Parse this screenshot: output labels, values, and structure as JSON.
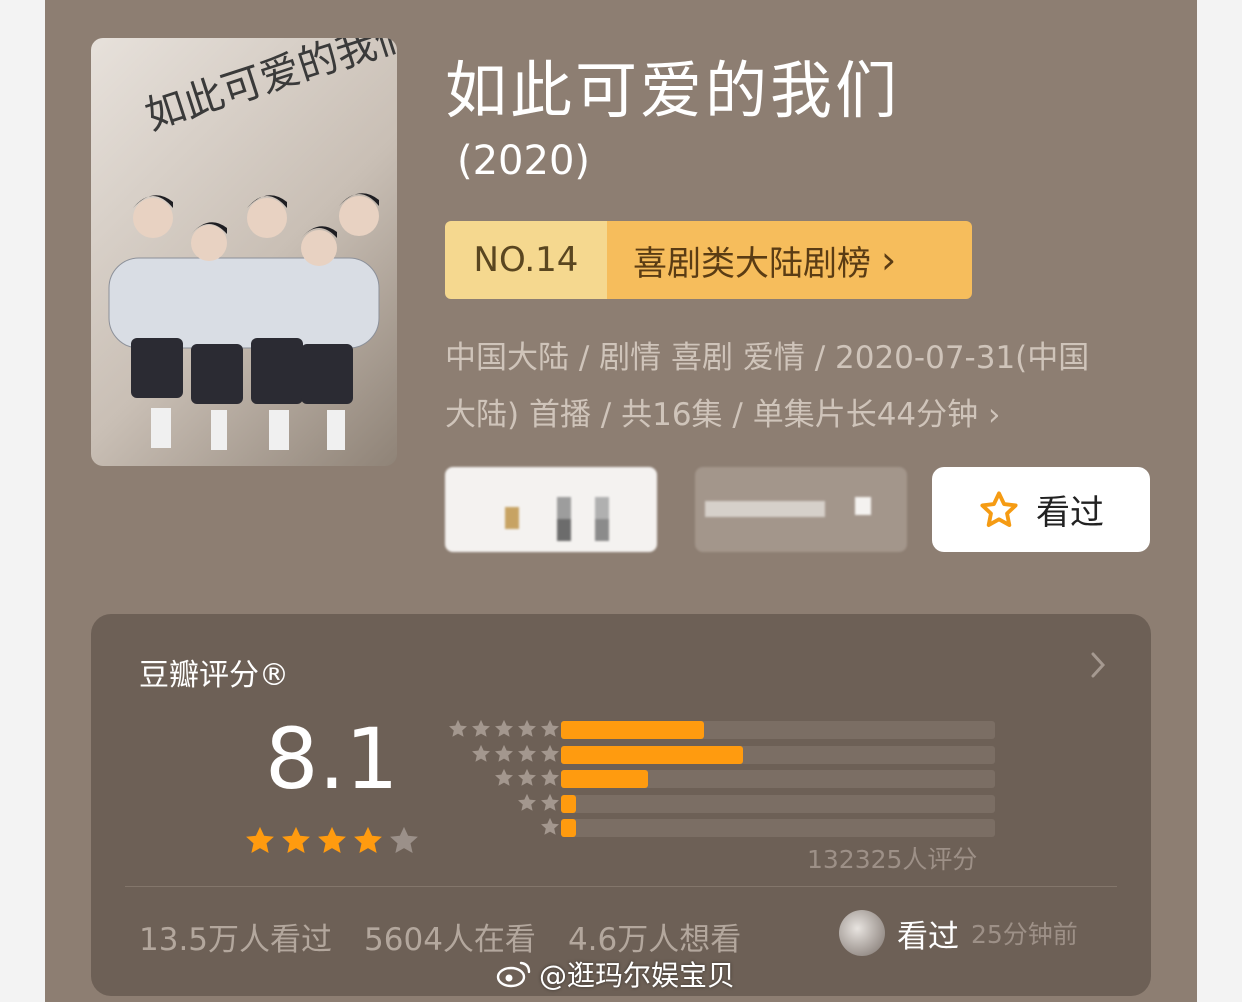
{
  "show": {
    "title": "如此可爱的我们",
    "year": "(2020)",
    "poster_title": "如此可爱的我们"
  },
  "ranking": {
    "number": "NO.14",
    "list_name": "喜剧类大陆剧榜",
    "chevron": "›"
  },
  "meta": {
    "line1": "中国大陆 / 剧情 喜剧 爱情 / 2020-07-31(中国",
    "line2": "大陆) 首播 / 共16集 / 单集片长44分钟",
    "chevron": "›"
  },
  "actions": {
    "seen_label": "看过",
    "seen_icon": "star-outline-icon"
  },
  "rating_card": {
    "title": "豆瓣评分®",
    "score": "8.1",
    "star_rating": 4,
    "star_max": 5,
    "rating_count": "132325人评分",
    "distribution": [
      {
        "stars": 5,
        "fraction": 0.33
      },
      {
        "stars": 4,
        "fraction": 0.42
      },
      {
        "stars": 3,
        "fraction": 0.2
      },
      {
        "stars": 2,
        "fraction": 0.035
      },
      {
        "stars": 1,
        "fraction": 0.035
      }
    ]
  },
  "stats": {
    "watched": "13.5万人看过",
    "watching": "5604人在看",
    "want": "4.6万人想看"
  },
  "latest": {
    "label": "看过",
    "time": "25分钟前"
  },
  "watermark": {
    "text": "@逛玛尔娱宝贝"
  },
  "colors": {
    "background": "#8d7e72",
    "card": "#6d6056",
    "accent_orange": "#ff9b0f",
    "rank_light": "#f5d88f",
    "rank_dark": "#f6bd5c"
  }
}
